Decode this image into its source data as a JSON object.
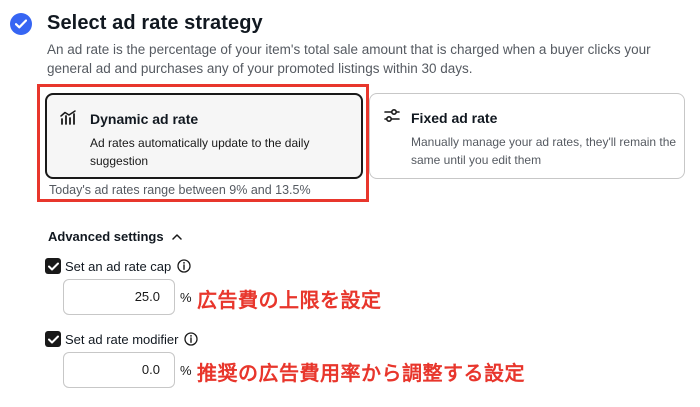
{
  "strategy": {
    "title": "Select ad rate strategy",
    "description": "An ad rate is the percentage of your item's total sale amount that is charged when a buyer clicks your general ad and purchases any of your promoted listings within 30 days.",
    "options": [
      {
        "title": "Dynamic ad rate",
        "description": "Ad rates automatically update to the daily suggestion",
        "selected": true,
        "icon": "dynamic-rate-icon"
      },
      {
        "title": "Fixed ad rate",
        "description": "Manually manage your ad rates, they'll remain the same until you edit them",
        "selected": false,
        "icon": "sliders-icon"
      }
    ],
    "range_text": "Today's ad rates range between 9% and 13.5%"
  },
  "advanced": {
    "header": "Advanced settings",
    "expanded": true,
    "cap": {
      "label": "Set an ad rate cap",
      "checked": true,
      "value": "25.0",
      "unit": "%"
    },
    "modifier": {
      "label": "Set ad rate modifier",
      "checked": true,
      "value": "0.0",
      "unit": "%"
    }
  },
  "annotations": {
    "cap_note": "広告費の上限を設定",
    "modifier_note": "推奨の広告費用率から調整する設定"
  },
  "colors": {
    "accent": "#3665f3",
    "annotation_red": "#e8362c",
    "text": "#111820",
    "muted": "#555a61"
  }
}
